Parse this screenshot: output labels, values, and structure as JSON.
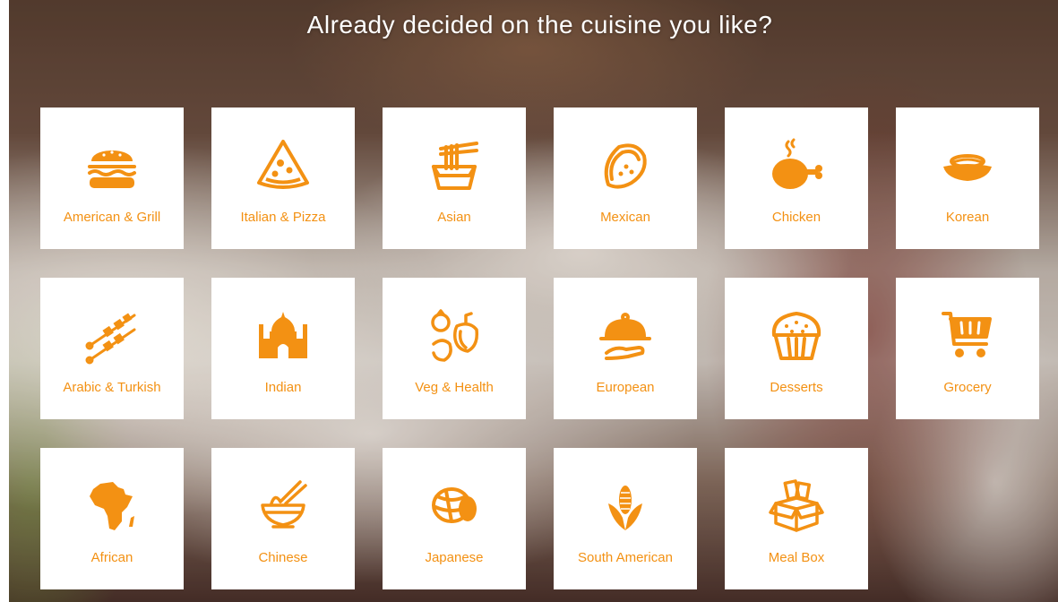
{
  "heading": "Already decided on the cuisine you like?",
  "accent_color": "#f39113",
  "cuisines": [
    {
      "label": "American & Grill",
      "icon": "burger-icon"
    },
    {
      "label": "Italian & Pizza",
      "icon": "pizza-icon"
    },
    {
      "label": "Asian",
      "icon": "noodle-box-icon"
    },
    {
      "label": "Mexican",
      "icon": "taco-icon"
    },
    {
      "label": "Chicken",
      "icon": "chicken-icon"
    },
    {
      "label": "Korean",
      "icon": "korean-bowl-icon"
    },
    {
      "label": "Arabic & Turkish",
      "icon": "kebab-skewer-icon"
    },
    {
      "label": "Indian",
      "icon": "taj-mahal-icon"
    },
    {
      "label": "Veg & Health",
      "icon": "vegetables-icon"
    },
    {
      "label": "European",
      "icon": "cloche-icon"
    },
    {
      "label": "Desserts",
      "icon": "muffin-icon"
    },
    {
      "label": "Grocery",
      "icon": "shopping-cart-icon"
    },
    {
      "label": "African",
      "icon": "africa-map-icon"
    },
    {
      "label": "Chinese",
      "icon": "noodle-bowl-chopsticks-icon"
    },
    {
      "label": "Japanese",
      "icon": "sushi-icon"
    },
    {
      "label": "South American",
      "icon": "corn-icon"
    },
    {
      "label": "Meal Box",
      "icon": "box-icon"
    }
  ]
}
